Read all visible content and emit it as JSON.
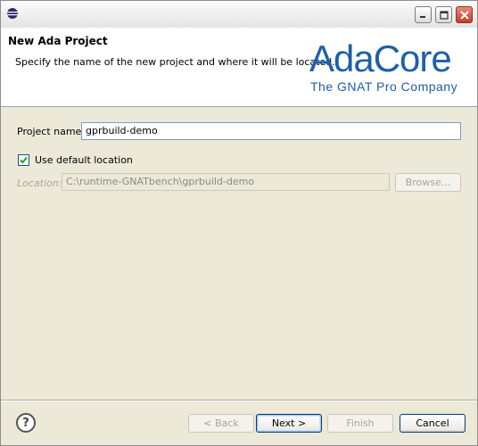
{
  "header": {
    "title": "New Ada Project",
    "description": "Specify the name of the new project and where it will be located.",
    "logo": {
      "main": "AdaCore",
      "sub": "The GNAT Pro Company"
    }
  },
  "form": {
    "project_name_label": "Project name:",
    "project_name_value": "gprbuild-demo",
    "use_default_label": "Use default location",
    "use_default_checked": true,
    "location_label": "Location:",
    "location_value": "C:\\runtime-GNATbench\\gprbuild-demo",
    "browse_label": "Browse..."
  },
  "footer": {
    "help_icon": "?",
    "back_label": "< Back",
    "next_label": "Next >",
    "finish_label": "Finish",
    "cancel_label": "Cancel"
  },
  "colors": {
    "logo": "#1e5fa8",
    "window_bg": "#ece9d8"
  }
}
